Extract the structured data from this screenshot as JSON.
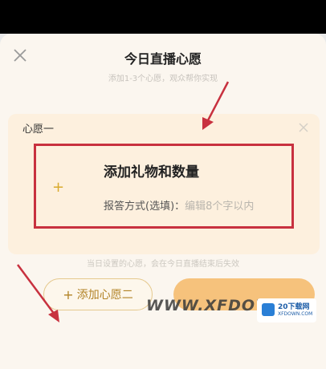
{
  "header": {
    "title": "今日直播心愿",
    "subtitle": "添加1-3个心愿，观众帮你实现"
  },
  "wish_card": {
    "title": "心愿一",
    "gift_label": "添加礼物和数量",
    "method_label": "报答方式(选填)：",
    "method_placeholder": "编辑8个字以内"
  },
  "footer": {
    "notice": "当日设置的心愿，会在今日直播结束后失效",
    "add_button_label": "添加心愿二"
  },
  "watermark": {
    "text": "WWW.XFDOWN",
    "logo_text": "20下载网",
    "logo_sub": "XFDOWN.COM"
  },
  "colors": {
    "accent": "#c8313f",
    "button_gold": "#b28326",
    "submit_orange": "#f6c27c"
  }
}
